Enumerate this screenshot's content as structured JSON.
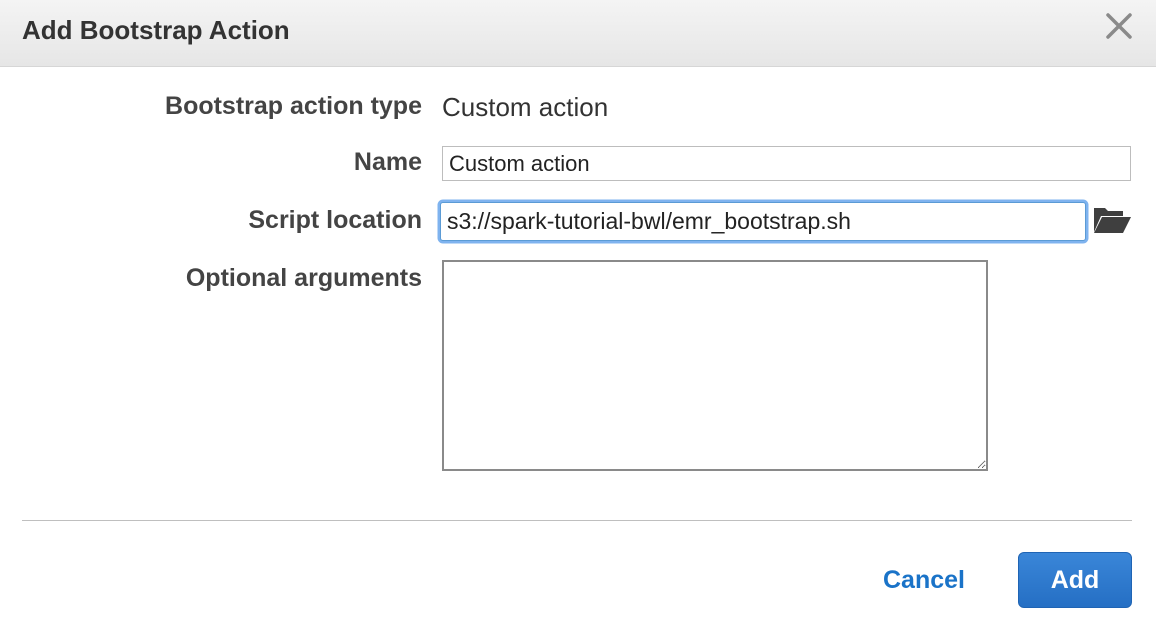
{
  "dialog": {
    "title": "Add Bootstrap Action",
    "close_icon": "close-icon"
  },
  "form": {
    "bootstrap_type_label": "Bootstrap action type",
    "bootstrap_type_value": "Custom action",
    "name_label": "Name",
    "name_value": "Custom action",
    "script_location_label": "Script location",
    "script_location_value": "s3://spark-tutorial-bwl/emr_bootstrap.sh",
    "folder_icon": "folder-open-icon",
    "optional_arguments_label": "Optional arguments",
    "optional_arguments_value": ""
  },
  "footer": {
    "cancel_label": "Cancel",
    "add_label": "Add"
  },
  "colors": {
    "accent": "#1a73c8",
    "primary_button": "#2a78cc",
    "focus_ring": "#7fb3ef"
  }
}
